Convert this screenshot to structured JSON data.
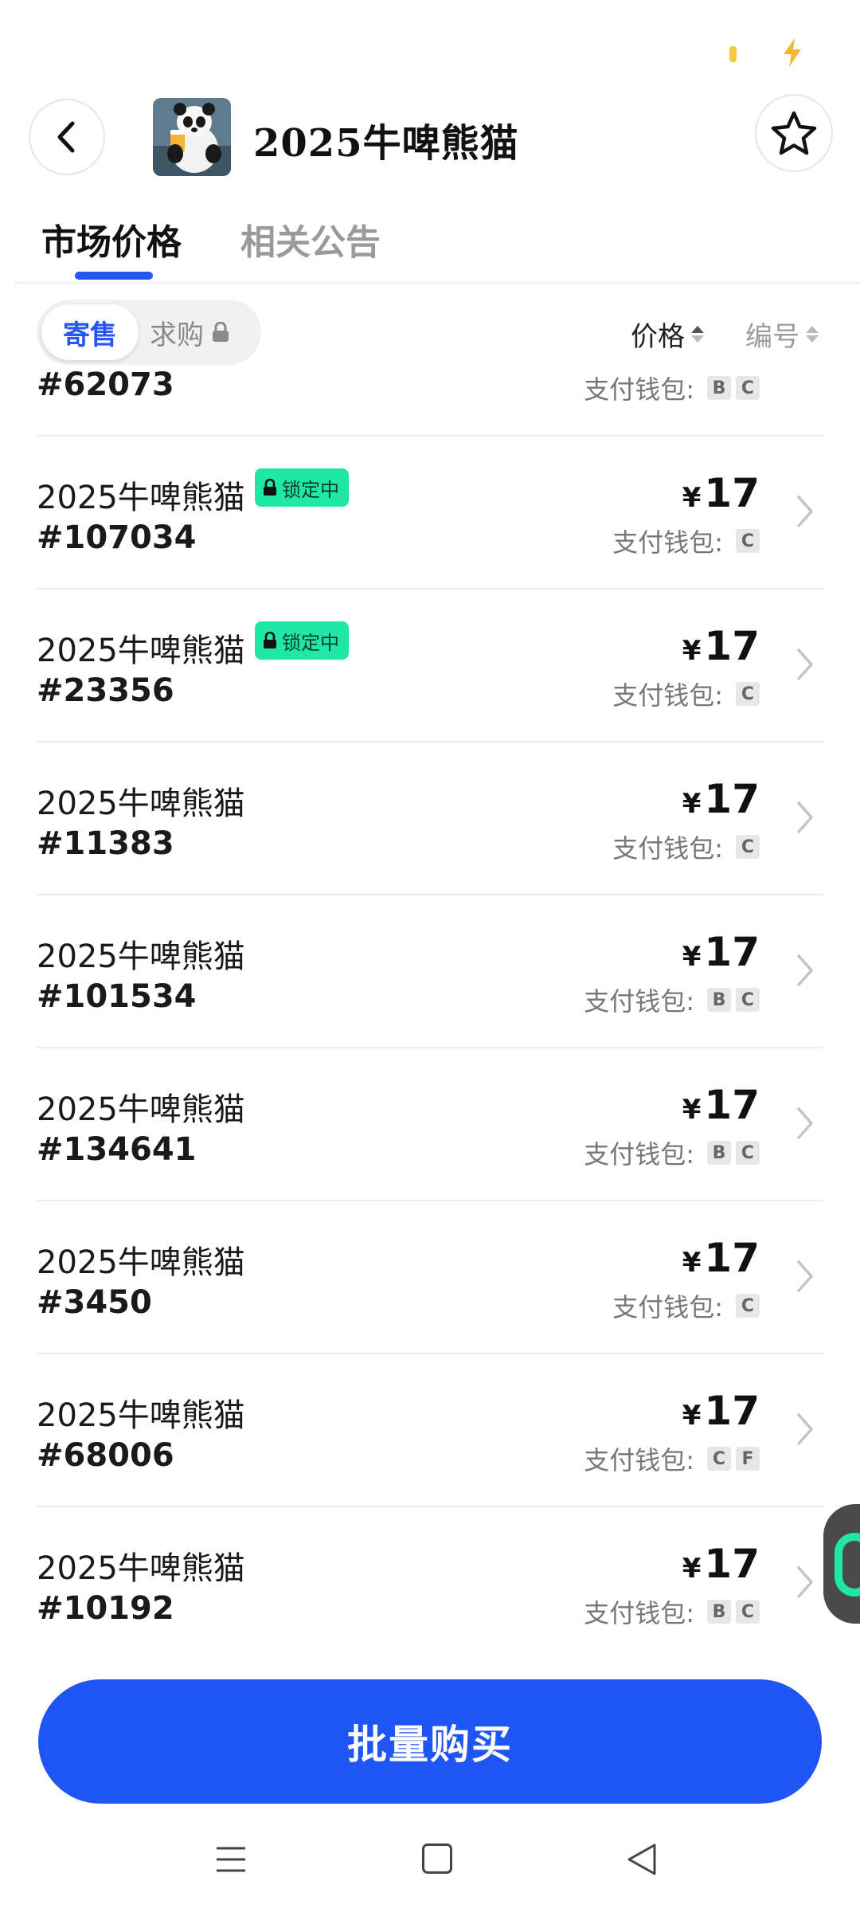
{
  "header": {
    "title": "2025牛啤熊猫",
    "thumbnail": "panda-with-beer",
    "thumbnail_caption": "2025"
  },
  "tabs": [
    {
      "label": "市场价格",
      "active": true
    },
    {
      "label": "相关公告",
      "active": false
    }
  ],
  "filters": {
    "consign_label": "寄售",
    "buy_request_label": "求购",
    "sort_price_label": "价格",
    "sort_number_label": "编号"
  },
  "currency_symbol": "¥",
  "wallet_label": "支付钱包:",
  "items": [
    {
      "name": "",
      "number": "#62073",
      "price": "",
      "locked": false,
      "wallets": [
        "B",
        "C"
      ]
    },
    {
      "name": "2025牛啤熊猫",
      "number": "#107034",
      "price": "17",
      "locked": true,
      "lock_label": "锁定中",
      "wallets": [
        "C"
      ]
    },
    {
      "name": "2025牛啤熊猫",
      "number": "#23356",
      "price": "17",
      "locked": true,
      "lock_label": "锁定中",
      "wallets": [
        "C"
      ]
    },
    {
      "name": "2025牛啤熊猫",
      "number": "#11383",
      "price": "17",
      "locked": false,
      "wallets": [
        "C"
      ]
    },
    {
      "name": "2025牛啤熊猫",
      "number": "#101534",
      "price": "17",
      "locked": false,
      "wallets": [
        "B",
        "C"
      ]
    },
    {
      "name": "2025牛啤熊猫",
      "number": "#134641",
      "price": "17",
      "locked": false,
      "wallets": [
        "B",
        "C"
      ]
    },
    {
      "name": "2025牛啤熊猫",
      "number": "#3450",
      "price": "17",
      "locked": false,
      "wallets": [
        "C"
      ]
    },
    {
      "name": "2025牛啤熊猫",
      "number": "#68006",
      "price": "17",
      "locked": false,
      "wallets": [
        "C",
        "F"
      ]
    },
    {
      "name": "2025牛啤熊猫",
      "number": "#10192",
      "price": "17",
      "locked": false,
      "wallets": [
        "B",
        "C"
      ]
    }
  ],
  "bulk_buy_label": "批量购买",
  "colors": {
    "accent": "#1f55f5",
    "lock_badge": "#1fe8a6",
    "status_pill": "#f7c843"
  }
}
